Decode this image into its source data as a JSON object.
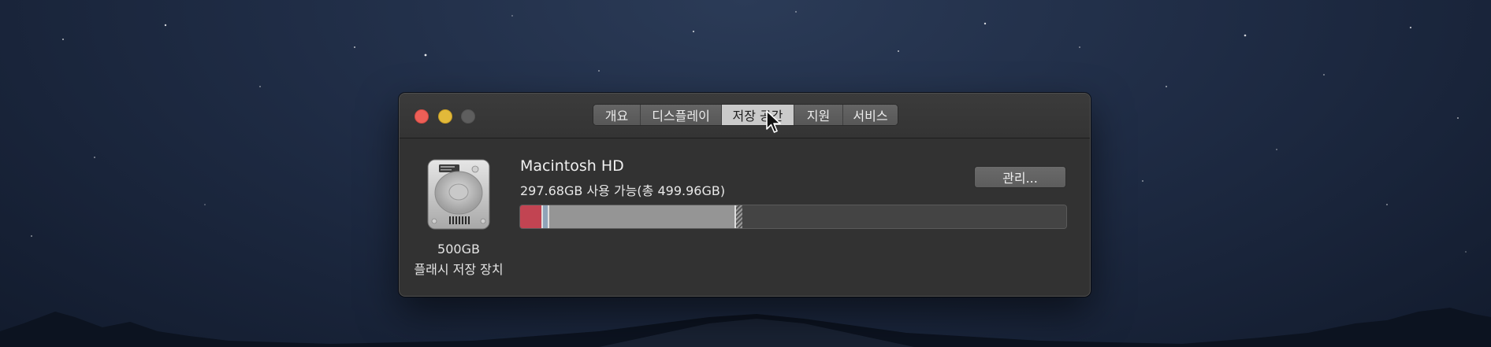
{
  "window": {
    "traffic_lights": [
      {
        "name": "close",
        "color": "#ed5f57"
      },
      {
        "name": "minimize",
        "color": "#e2b93a"
      },
      {
        "name": "zoom",
        "color": "#5e5e5e"
      }
    ]
  },
  "tabs": [
    {
      "label": "개요"
    },
    {
      "label": "디스플레이"
    },
    {
      "label": "저장 공간",
      "active": true
    },
    {
      "label": "지원"
    },
    {
      "label": "서비스"
    }
  ],
  "disk": {
    "icon": "hard-drive-icon",
    "size_label": "500GB",
    "type_label": "플래시 저장 장치"
  },
  "volume": {
    "name": "Macintosh HD",
    "info": "297.68GB 사용 가능(총 499.96GB)"
  },
  "manage_button": {
    "label": "관리..."
  },
  "storage": {
    "total_gb": 499.96,
    "available_gb": 297.68,
    "segments": [
      {
        "name": "red",
        "color": "#c24452",
        "fraction": 0.039
      },
      {
        "name": "blue",
        "color": "#8fa3b8",
        "fraction": 0.009
      },
      {
        "name": "grey",
        "color": "#959595",
        "fraction": 0.339
      },
      {
        "name": "hatched",
        "color": "#9a9a9a",
        "fraction": 0.012
      }
    ]
  }
}
